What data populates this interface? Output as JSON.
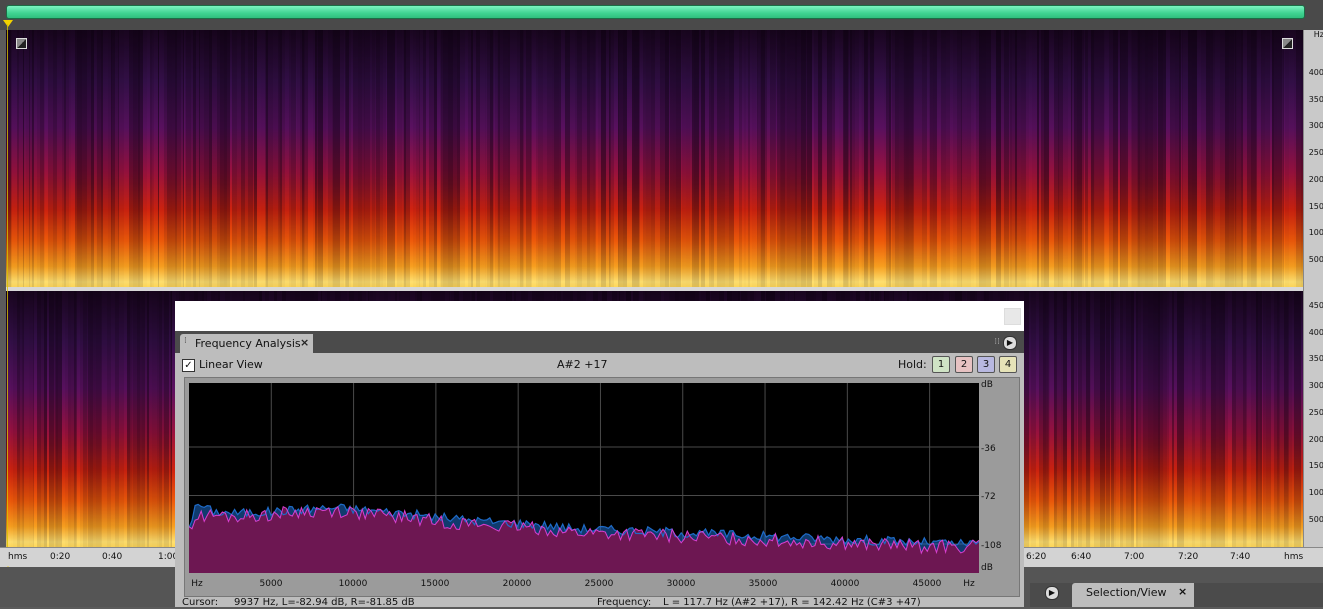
{
  "spectral_display": {
    "frequency_axis": {
      "unit": "Hz",
      "top_channel_ticks": [
        "400",
        "350",
        "300",
        "250",
        "200",
        "150",
        "100",
        "500"
      ],
      "bottom_channel_ticks": [
        "450",
        "400",
        "350",
        "300",
        "250",
        "200",
        "150",
        "100",
        "500"
      ]
    },
    "time_axis": {
      "unit_label": "hms",
      "visible_labels": [
        "0:20",
        "0:40",
        "1:00",
        "6:20",
        "6:40",
        "7:00",
        "7:20",
        "7:40"
      ]
    }
  },
  "frequency_analysis": {
    "tab_label": "Frequency Analysis",
    "linear_view": {
      "label": "Linear View",
      "checked": true
    },
    "note_readout": "A#2 +17",
    "hold": {
      "label": "Hold:",
      "buttons": [
        "1",
        "2",
        "3",
        "4"
      ],
      "colors": [
        "#cfe3c5",
        "#e7c2c2",
        "#b8b8e0",
        "#e6e3b8"
      ]
    },
    "y_axis_labels": [
      "dB",
      "-36",
      "-72",
      "-108",
      "dB"
    ],
    "x_axis_labels": [
      "Hz",
      "5000",
      "10000",
      "15000",
      "20000",
      "25000",
      "30000",
      "35000",
      "40000",
      "45000",
      "Hz"
    ],
    "status": {
      "cursor_label": "Cursor:",
      "cursor_value": "9937 Hz, L=-82.94 dB, R=-81.85 dB",
      "frequency_label": "Frequency:",
      "frequency_value": "L = 117.7 Hz (A#2 +17), R = 142.42 Hz (C#3 +47)"
    },
    "colors": {
      "left_channel": "#d83fd0",
      "right_channel": "#1e6bc8",
      "fill": "#6d1752"
    }
  },
  "selection_view_tab": {
    "label": "Selection/View"
  },
  "chart_data": {
    "type": "area",
    "x_unit": "Hz",
    "y_unit": "dB",
    "xlim": [
      0,
      48000
    ],
    "y_ticks": [
      -36,
      -72,
      -108
    ],
    "series": [
      {
        "x": [
          0,
          500,
          1500,
          3000,
          5000,
          7000,
          9000,
          11000,
          13000,
          15000,
          17000,
          19000,
          21000,
          23000,
          25000,
          27000,
          29000,
          31000,
          33000,
          35000,
          37000,
          39000,
          41000,
          43000,
          45000,
          47000,
          48000
        ],
        "values": [
          -94,
          -78,
          -84,
          -85,
          -84,
          -82,
          -81,
          -83,
          -85,
          -88,
          -90,
          -92,
          -93,
          -96,
          -97,
          -98,
          -99,
          -100,
          -101,
          -102,
          -103,
          -104,
          -105,
          -106,
          -107,
          -108,
          -108
        ]
      },
      {
        "x": [
          0,
          500,
          1500,
          3000,
          5000,
          7000,
          9000,
          11000,
          13000,
          15000,
          17000,
          19000,
          21000,
          23000,
          25000,
          27000,
          29000,
          31000,
          33000,
          35000,
          37000,
          39000,
          41000,
          43000,
          45000,
          47000,
          48000
        ],
        "values": [
          -95,
          -88,
          -87,
          -88,
          -86,
          -84,
          -83,
          -86,
          -88,
          -91,
          -93,
          -95,
          -96,
          -99,
          -100,
          -101,
          -102,
          -103,
          -104,
          -105,
          -106,
          -107,
          -108,
          -109,
          -110,
          -110,
          -110
        ]
      }
    ]
  }
}
